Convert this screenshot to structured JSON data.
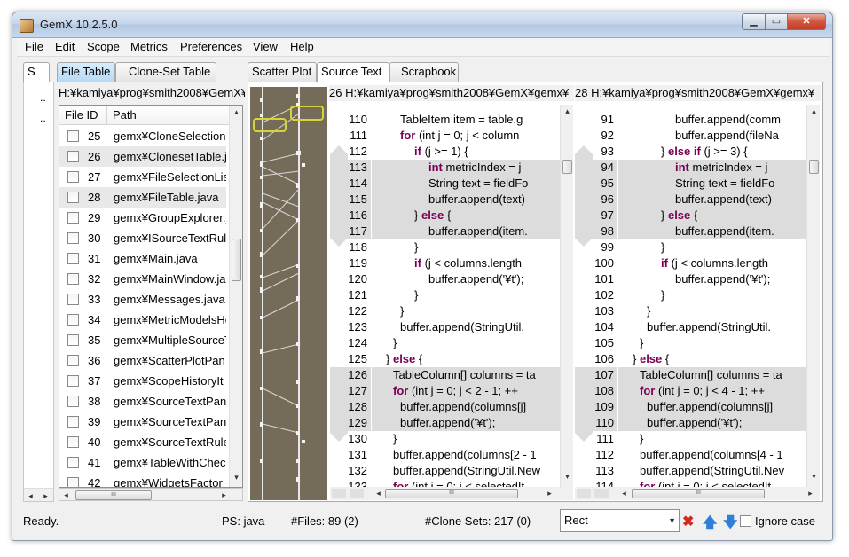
{
  "window": {
    "title": "GemX 10.2.5.0",
    "icon": "gemx-app-icon"
  },
  "window_controls": {
    "minimize": "▁",
    "maximize": "▭",
    "close": "✕"
  },
  "menu": [
    "File",
    "Edit",
    "Scope",
    "Metrics",
    "Preferences",
    "View",
    "Help"
  ],
  "left_panel": {
    "collapsed_tab": "S",
    "dots": [
      "..",
      ".."
    ],
    "tabs": [
      "File Table",
      "Clone-Set Table"
    ],
    "path": "H:¥kamiya¥prog¥smith2008¥GemX¥",
    "columns": [
      "File ID",
      "Path"
    ],
    "rows": [
      {
        "id": "25",
        "path": "gemx¥CloneSelectionI",
        "highlight": false
      },
      {
        "id": "26",
        "path": "gemx¥ClonesetTable.j",
        "highlight": true
      },
      {
        "id": "27",
        "path": "gemx¥FileSelectionLis",
        "highlight": false
      },
      {
        "id": "28",
        "path": "gemx¥FileTable.java",
        "highlight": true
      },
      {
        "id": "29",
        "path": "gemx¥GroupExplorer.j",
        "highlight": false
      },
      {
        "id": "30",
        "path": "gemx¥ISourceTextRul",
        "highlight": false
      },
      {
        "id": "31",
        "path": "gemx¥Main.java",
        "highlight": false
      },
      {
        "id": "32",
        "path": "gemx¥MainWindow.ja",
        "highlight": false
      },
      {
        "id": "33",
        "path": "gemx¥Messages.java",
        "highlight": false
      },
      {
        "id": "34",
        "path": "gemx¥MetricModelsHo",
        "highlight": false
      },
      {
        "id": "35",
        "path": "gemx¥MultipleSourceT",
        "highlight": false
      },
      {
        "id": "36",
        "path": "gemx¥ScatterPlotPan",
        "highlight": false
      },
      {
        "id": "37",
        "path": "gemx¥ScopeHistoryIt",
        "highlight": false
      },
      {
        "id": "38",
        "path": "gemx¥SourceTextPan",
        "highlight": false
      },
      {
        "id": "39",
        "path": "gemx¥SourceTextPan",
        "highlight": false
      },
      {
        "id": "40",
        "path": "gemx¥SourceTextRule",
        "highlight": false
      },
      {
        "id": "41",
        "path": "gemx¥TableWithChec",
        "highlight": false
      },
      {
        "id": "42",
        "path": "gemx¥WidgetsFactor",
        "highlight": false
      }
    ]
  },
  "right_panel": {
    "tabs": [
      "Scatter Plot",
      "Source Text",
      "Scrapbook"
    ],
    "active_tab": "Source Text",
    "pane1": {
      "header": "26 H:¥kamiya¥prog¥smith2008¥GemX¥gemx¥",
      "lines": [
        {
          "n": "110",
          "indent": 4,
          "text": "TableItem item = table.g",
          "kw": "",
          "shade": false
        },
        {
          "n": "111",
          "indent": 4,
          "text": " (int j = 0; j < column",
          "kw": "for",
          "shade": false
        },
        {
          "n": "112",
          "indent": 6,
          "text": " (j >= 1) {",
          "kw": "if",
          "shade": false
        },
        {
          "n": "113",
          "indent": 8,
          "text": " metricIndex = j",
          "kw": "int",
          "shade": true
        },
        {
          "n": "114",
          "indent": 8,
          "text": "String text = fieldFo",
          "kw": "",
          "shade": true
        },
        {
          "n": "115",
          "indent": 8,
          "text": "buffer.append(text)",
          "kw": "",
          "shade": true
        },
        {
          "n": "116",
          "indent": 6,
          "text": "} ",
          "kw": "",
          "kw2": "else",
          "tail": " {",
          "shade": true
        },
        {
          "n": "117",
          "indent": 8,
          "text": "buffer.append(item.",
          "kw": "",
          "shade": true
        },
        {
          "n": "118",
          "indent": 6,
          "text": "}",
          "kw": "",
          "shade": false
        },
        {
          "n": "119",
          "indent": 6,
          "text": " (j < columns.length",
          "kw": "if",
          "shade": false
        },
        {
          "n": "120",
          "indent": 8,
          "text": "buffer.append('¥t');",
          "kw": "",
          "shade": false
        },
        {
          "n": "121",
          "indent": 6,
          "text": "}",
          "kw": "",
          "shade": false
        },
        {
          "n": "122",
          "indent": 4,
          "text": "}",
          "kw": "",
          "shade": false
        },
        {
          "n": "123",
          "indent": 4,
          "text": "buffer.append(StringUtil.",
          "kw": "",
          "shade": false
        },
        {
          "n": "124",
          "indent": 3,
          "text": "}",
          "kw": "",
          "shade": false
        },
        {
          "n": "125",
          "indent": 2,
          "text": "} ",
          "kw": "",
          "kw2": "else",
          "tail": " {",
          "shade": false
        },
        {
          "n": "126",
          "indent": 3,
          "text": "TableColumn[] columns = ta",
          "kw": "",
          "shade": true
        },
        {
          "n": "127",
          "indent": 3,
          "text": " (int j = 0; j < 2 - 1; ++",
          "kw": "for",
          "shade": true
        },
        {
          "n": "128",
          "indent": 4,
          "text": "buffer.append(columns[j]",
          "kw": "",
          "shade": true
        },
        {
          "n": "129",
          "indent": 4,
          "text": "buffer.append('¥t');",
          "kw": "",
          "shade": true
        },
        {
          "n": "130",
          "indent": 3,
          "text": "}",
          "kw": "",
          "shade": false
        },
        {
          "n": "131",
          "indent": 3,
          "text": "buffer.append(columns[2 - 1",
          "kw": "",
          "shade": false
        },
        {
          "n": "132",
          "indent": 3,
          "text": "buffer.append(StringUtil.New",
          "kw": "",
          "shade": false
        },
        {
          "n": "133",
          "indent": 3,
          "text": " (int i = 0; i < selectedIt",
          "kw": "for",
          "shade": false
        }
      ]
    },
    "pane2": {
      "header": "28 H:¥kamiya¥prog¥smith2008¥GemX¥gemx¥",
      "lines": [
        {
          "n": "91",
          "indent": 8,
          "text": "buffer.append(comm",
          "kw": "",
          "shade": false
        },
        {
          "n": "92",
          "indent": 8,
          "text": "buffer.append(fileNa",
          "kw": "",
          "shade": false
        },
        {
          "n": "93",
          "indent": 6,
          "text": "} ",
          "kw": "",
          "kw2": "else if",
          "tail": " (j >= 3) {",
          "shade": false
        },
        {
          "n": "94",
          "indent": 8,
          "text": " metricIndex = j",
          "kw": "int",
          "shade": true
        },
        {
          "n": "95",
          "indent": 8,
          "text": "String text = fieldFo",
          "kw": "",
          "shade": true
        },
        {
          "n": "96",
          "indent": 8,
          "text": "buffer.append(text)",
          "kw": "",
          "shade": true
        },
        {
          "n": "97",
          "indent": 6,
          "text": "} ",
          "kw": "",
          "kw2": "else",
          "tail": " {",
          "shade": true
        },
        {
          "n": "98",
          "indent": 8,
          "text": "buffer.append(item.",
          "kw": "",
          "shade": true
        },
        {
          "n": "99",
          "indent": 6,
          "text": "}",
          "kw": "",
          "shade": false
        },
        {
          "n": "100",
          "indent": 6,
          "text": " (j < columns.length",
          "kw": "if",
          "shade": false
        },
        {
          "n": "101",
          "indent": 8,
          "text": "buffer.append('¥t');",
          "kw": "",
          "shade": false
        },
        {
          "n": "102",
          "indent": 6,
          "text": "}",
          "kw": "",
          "shade": false
        },
        {
          "n": "103",
          "indent": 4,
          "text": "}",
          "kw": "",
          "shade": false
        },
        {
          "n": "104",
          "indent": 4,
          "text": "buffer.append(StringUtil.",
          "kw": "",
          "shade": false
        },
        {
          "n": "105",
          "indent": 3,
          "text": "}",
          "kw": "",
          "shade": false
        },
        {
          "n": "106",
          "indent": 2,
          "text": "} ",
          "kw": "",
          "kw2": "else",
          "tail": " {",
          "shade": false
        },
        {
          "n": "107",
          "indent": 3,
          "text": "TableColumn[] columns = ta",
          "kw": "",
          "shade": true
        },
        {
          "n": "108",
          "indent": 3,
          "text": " (int j = 0; j < 4 - 1; ++",
          "kw": "for",
          "shade": true
        },
        {
          "n": "109",
          "indent": 4,
          "text": "buffer.append(columns[j]",
          "kw": "",
          "shade": true
        },
        {
          "n": "110",
          "indent": 4,
          "text": "buffer.append('¥t');",
          "kw": "",
          "shade": true
        },
        {
          "n": "111",
          "indent": 3,
          "text": "}",
          "kw": "",
          "shade": false
        },
        {
          "n": "112",
          "indent": 3,
          "text": "buffer.append(columns[4 - 1",
          "kw": "",
          "shade": false
        },
        {
          "n": "113",
          "indent": 3,
          "text": "buffer.append(StringUtil.Nev",
          "kw": "",
          "shade": false
        },
        {
          "n": "114",
          "indent": 3,
          "text": " (int i = 0; i < selectedIt",
          "kw": "for",
          "shade": false
        }
      ]
    }
  },
  "status": {
    "ready": "Ready.",
    "ps": "PS: java",
    "files": "#Files: 89 (2)",
    "clone_sets": "#Clone Sets: 217 (0)",
    "search_value": "Rect",
    "ignore_case_label": "Ignore case",
    "clear_icon": "✖",
    "up_icon": "🡅",
    "down_icon": "🡇"
  },
  "colors": {
    "keyword": "#7a0055",
    "scatter_bg": "#746b58",
    "selection_box": "#d8d33a",
    "file_tab_active": "#b7daf5"
  }
}
